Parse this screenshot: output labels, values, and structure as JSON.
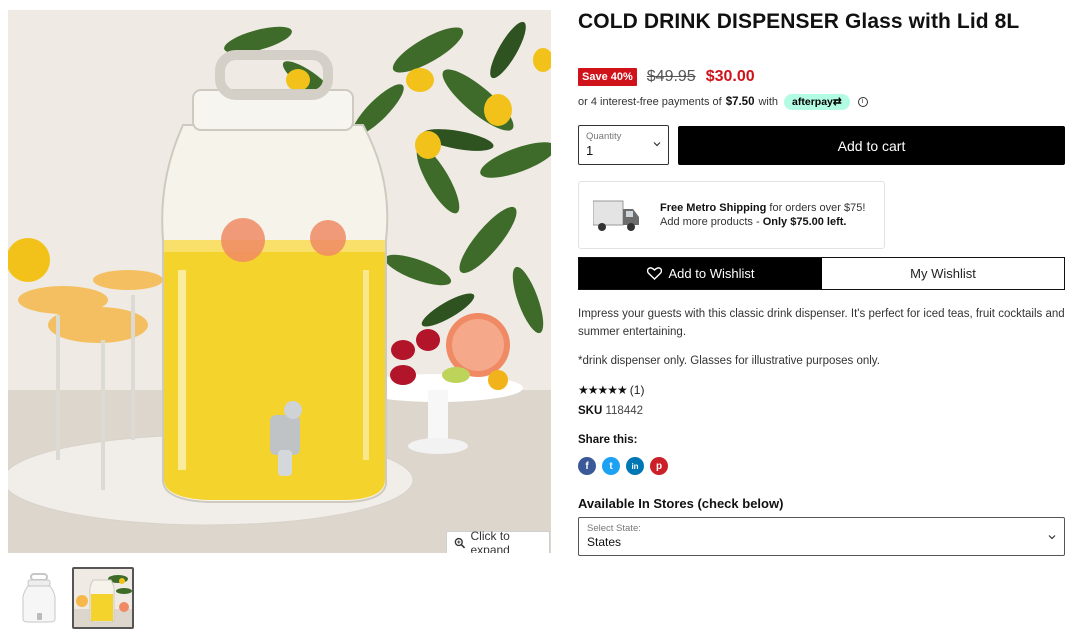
{
  "gallery": {
    "expand_label": "Click to expand"
  },
  "product": {
    "title": "COLD DRINK DISPENSER Glass with Lid 8L",
    "save_badge": "Save 40%",
    "old_price": "$49.95",
    "new_price": "$30.00"
  },
  "afterpay": {
    "prefix": "or 4 interest-free payments of",
    "amount": "$7.50",
    "with": "with",
    "brand": "afterpay",
    "info": "i"
  },
  "cart": {
    "quantity_label": "Quantity",
    "quantity_value": "1",
    "add_label": "Add to cart"
  },
  "shipping": {
    "bold": "Free Metro Shipping",
    "rest": " for orders over $75!",
    "line2_prefix": "Add more products - ",
    "line2_bold": "Only $75.00 left."
  },
  "wishlist": {
    "add_label": "Add to Wishlist",
    "my_label": "My Wishlist"
  },
  "details": {
    "description": "Impress your guests with this classic drink dispenser. It's perfect for iced teas, fruit cocktails and summer entertaining.",
    "note": "*drink dispenser only. Glasses for illustrative purposes only.",
    "stars": "★★★★★",
    "rating_count": "(1)",
    "sku_label": "SKU",
    "sku_value": "118442",
    "rating": 5
  },
  "share": {
    "label": "Share this:",
    "icons": [
      {
        "name": "facebook-icon",
        "glyph": "f",
        "color": "#3b5998"
      },
      {
        "name": "twitter-icon",
        "glyph": "t",
        "color": "#1da1f2"
      },
      {
        "name": "linkedin-icon",
        "glyph": "in",
        "color": "#0077b5"
      },
      {
        "name": "pinterest-icon",
        "glyph": "p",
        "color": "#cb2027"
      }
    ]
  },
  "stores": {
    "label": "Available In Stores (check below)",
    "select_label": "Select State:",
    "select_value": "States"
  },
  "colors": {
    "accent_red": "#d0131a",
    "afterpay_mint": "#b2fce4"
  }
}
